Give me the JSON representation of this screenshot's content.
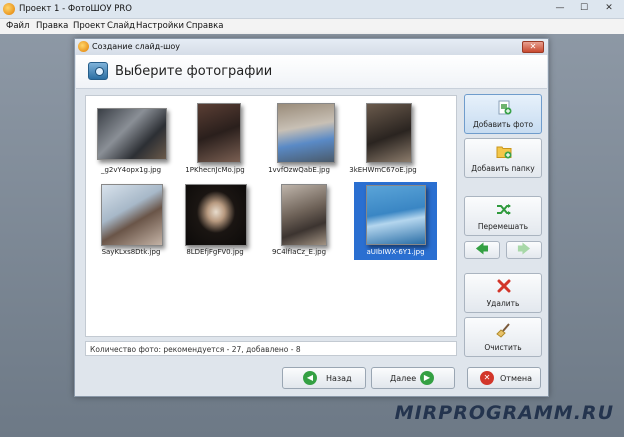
{
  "app": {
    "title": "Проект 1 - ФотоШОУ PRO",
    "window_buttons": {
      "minimize": "—",
      "maximize": "☐",
      "close": "✕"
    }
  },
  "menu": [
    "Файл",
    "Правка",
    "Проект",
    "Слайд",
    "Настройки",
    "Справка"
  ],
  "dialog": {
    "title": "Создание слайд-шоу",
    "close": "✕",
    "header": "Выберите фотографии",
    "photos": [
      {
        "name": "_g2vY4opx1g.jpg",
        "selected": false
      },
      {
        "name": "1PKhecnJcMo.jpg",
        "selected": false
      },
      {
        "name": "1vvfOzwQabE.jpg",
        "selected": false
      },
      {
        "name": "3kEHWmC67oE.jpg",
        "selected": false
      },
      {
        "name": "SayKLxs8Dtk.jpg",
        "selected": false
      },
      {
        "name": "8LDEfjFgFV0.jpg",
        "selected": false
      },
      {
        "name": "9C4lfIaCz_E.jpg",
        "selected": false
      },
      {
        "name": "aUIbIWX-6Y1.jpg",
        "selected": true
      }
    ],
    "status": "Количество фото: рекомендуется - 27, добавлено - 8",
    "side_buttons": {
      "add_photo": "Добавить фото",
      "add_folder": "Добавить папку",
      "shuffle": "Перемешать",
      "delete": "Удалить",
      "clear": "Очистить"
    },
    "arrows": {
      "left": "🡄",
      "right": "🡆"
    },
    "bottom_buttons": {
      "back": "Назад",
      "next": "Далее",
      "cancel": "Отмена"
    },
    "colors": {
      "accent": "#2a6fd1",
      "back_icon": "#34a043",
      "cancel_icon": "#d2362a"
    }
  },
  "watermark": "MIRPROGRAMM.RU"
}
